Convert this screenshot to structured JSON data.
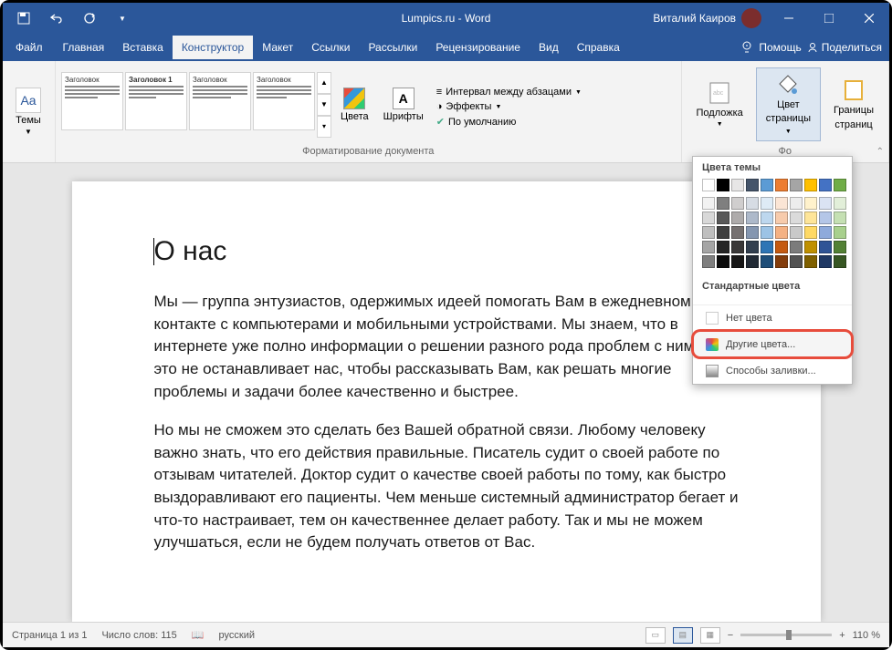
{
  "titlebar": {
    "docTitle": "Lumpics.ru - Word",
    "userName": "Виталий Каиров"
  },
  "menubar": {
    "tabs": {
      "file": "Файл",
      "home": "Главная",
      "insert": "Вставка",
      "design": "Конструктор",
      "layout": "Макет",
      "references": "Ссылки",
      "mailings": "Рассылки",
      "review": "Рецензирование",
      "view": "Вид",
      "help": "Справка"
    },
    "help": "Помощь",
    "share": "Поделиться"
  },
  "ribbon": {
    "themesLabel": "Темы",
    "styleGallery": [
      "Заголовок",
      "Заголовок 1",
      "Заголовок",
      "Заголовок"
    ],
    "groupFormatLabel": "Форматирование документа",
    "colorsLabel": "Цвета",
    "fontsLabel": "Шрифты",
    "spacingLabel": "Интервал между абзацами",
    "effectsLabel": "Эффекты",
    "defaultLabel": "По умолчанию",
    "watermarkLabel": "Подложка",
    "pageColorLabel1": "Цвет",
    "pageColorLabel2": "страницы",
    "bordersLabel1": "Границы",
    "bordersLabel2": "страниц",
    "groupPageBgLabel": "Фо"
  },
  "colorPopup": {
    "themeColorsLabel": "Цвета темы",
    "themeColors": [
      [
        "#ffffff",
        "#000000",
        "#e7e6e6",
        "#44546a",
        "#5b9bd5",
        "#ed7d31",
        "#a5a5a5",
        "#ffc000",
        "#4472c4",
        "#70ad47"
      ],
      [
        "#f2f2f2",
        "#7f7f7f",
        "#d0cece",
        "#d6dce4",
        "#deebf6",
        "#fbe5d5",
        "#ededed",
        "#fff2cc",
        "#dae3f3",
        "#e2efd9"
      ],
      [
        "#d8d8d8",
        "#595959",
        "#aeabab",
        "#adb9ca",
        "#bdd7ee",
        "#f7cbac",
        "#dbdbdb",
        "#fee599",
        "#b4c6e7",
        "#c5e0b3"
      ],
      [
        "#bfbfbf",
        "#3f3f3f",
        "#757070",
        "#8496b0",
        "#9cc3e5",
        "#f4b183",
        "#c9c9c9",
        "#ffd965",
        "#8eaadb",
        "#a8d08d"
      ],
      [
        "#a5a5a5",
        "#262626",
        "#3a3838",
        "#323f4f",
        "#2e75b5",
        "#c55a11",
        "#7b7b7b",
        "#bf9000",
        "#2f5496",
        "#538135"
      ],
      [
        "#7f7f7f",
        "#0c0c0c",
        "#171616",
        "#222a35",
        "#1e4e79",
        "#833c0b",
        "#525252",
        "#7f6000",
        "#1f3864",
        "#375623"
      ]
    ],
    "standardColorsLabel": "Стандартные цвета",
    "standardColors": [
      "#c00000",
      "#ff0000",
      "#ffc000",
      "#ffff00",
      "#92d050",
      "#00b050",
      "#00b0f0",
      "#0070c0",
      "#002060",
      "#7030a0"
    ],
    "noColorLabel": "Нет цвета",
    "moreColorsLabel": "Другие цвета...",
    "fillEffectsLabel": "Способы заливки..."
  },
  "document": {
    "heading": "О нас",
    "p1": "Мы — группа энтузиастов, одержимых идеей помогать Вам в ежедневном контакте с компьютерами и мобильными устройствами. Мы знаем, что в интернете уже полно информации о решении разного рода проблем с ними. Но это не останавливает нас, чтобы рассказывать Вам, как решать многие проблемы и задачи более качественно и быстрее.",
    "p2": "Но мы не сможем это сделать без Вашей обратной связи. Любому человеку важно знать, что его действия правильные. Писатель судит о своей работе по отзывам читателей. Доктор судит о качестве своей работы по тому, как быстро выздоравливают его пациенты. Чем меньше системный администратор бегает и что-то настраивает, тем он качественнее делает работу. Так и мы не можем улучшаться, если не будем получать ответов от Вас."
  },
  "statusbar": {
    "page": "Страница 1 из 1",
    "words": "Число слов: 115",
    "lang": "русский",
    "zoom": "110 %"
  }
}
